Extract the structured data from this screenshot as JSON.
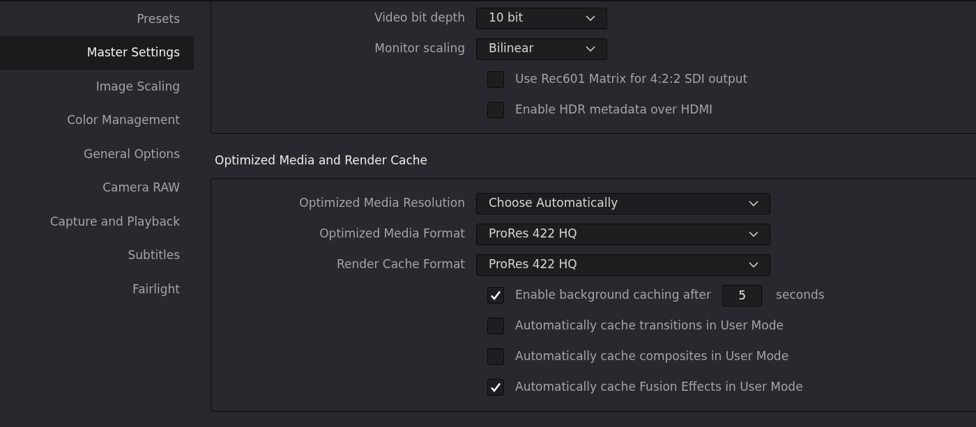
{
  "sidebar": {
    "items": [
      {
        "label": "Presets",
        "selected": false
      },
      {
        "label": "Master Settings",
        "selected": true
      },
      {
        "label": "Image Scaling",
        "selected": false
      },
      {
        "label": "Color Management",
        "selected": false
      },
      {
        "label": "General Options",
        "selected": false
      },
      {
        "label": "Camera RAW",
        "selected": false
      },
      {
        "label": "Capture and Playback",
        "selected": false
      },
      {
        "label": "Subtitles",
        "selected": false
      },
      {
        "label": "Fairlight",
        "selected": false
      }
    ]
  },
  "sections": [
    {
      "rows": [
        {
          "kind": "dropdown",
          "label": "Video bit depth",
          "value": "10 bit"
        },
        {
          "kind": "dropdown",
          "label": "Monitor scaling",
          "value": "Bilinear"
        },
        {
          "kind": "checkbox",
          "label": "Use Rec601 Matrix for 4:2:2 SDI output",
          "checked": false
        },
        {
          "kind": "checkbox",
          "label": "Enable HDR metadata over HDMI",
          "checked": false
        }
      ]
    },
    {
      "title": "Optimized Media and Render Cache",
      "rows": [
        {
          "kind": "dropdown",
          "label": "Optimized Media Resolution",
          "value": "Choose Automatically"
        },
        {
          "kind": "dropdown",
          "label": "Optimized Media Format",
          "value": "ProRes 422 HQ"
        },
        {
          "kind": "dropdown",
          "label": "Render Cache Format",
          "value": "ProRes 422 HQ"
        },
        {
          "kind": "checkbox_input",
          "label": "Enable background caching after",
          "checked": true,
          "value": "5",
          "suffix": "seconds"
        },
        {
          "kind": "checkbox",
          "label": "Automatically cache transitions in User Mode",
          "checked": false
        },
        {
          "kind": "checkbox",
          "label": "Automatically cache composites in User Mode",
          "checked": false
        },
        {
          "kind": "checkbox",
          "label": "Automatically cache Fusion Effects in User Mode",
          "checked": true
        }
      ]
    }
  ]
}
